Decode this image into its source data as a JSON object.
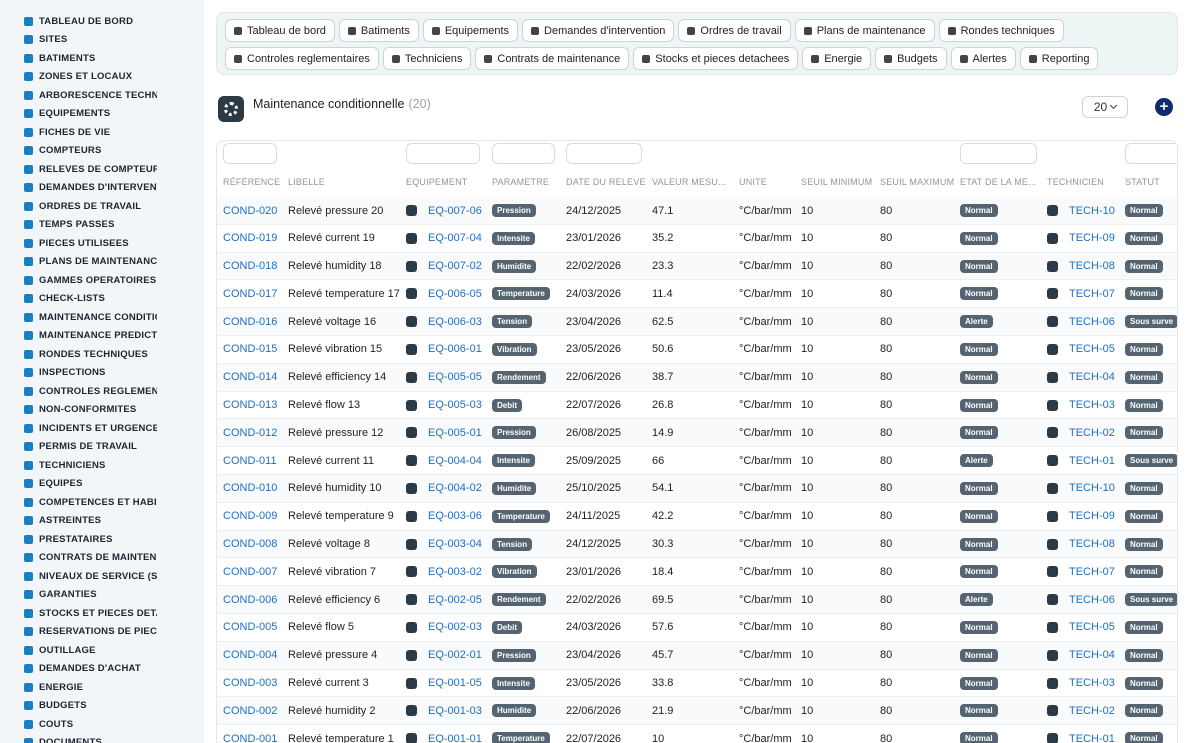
{
  "sidebar": {
    "items": [
      {
        "label": "TABLEAU DE BORD",
        "icon": "dashboard-icon"
      },
      {
        "label": "SITES",
        "icon": "location-pin-icon"
      },
      {
        "label": "BATIMENTS",
        "icon": "building-icon"
      },
      {
        "label": "ZONES ET LOCAUX",
        "icon": "grid-icon"
      },
      {
        "label": "ARBORESCENCE TECHNI",
        "icon": "hierarchy-icon"
      },
      {
        "label": "EQUIPEMENTS",
        "icon": "gears-icon"
      },
      {
        "label": "FICHES DE VIE",
        "icon": "history-icon"
      },
      {
        "label": "COMPTEURS",
        "icon": "gauge-icon"
      },
      {
        "label": "RELEVES DE COMPTEURS",
        "icon": "clipboard-icon"
      },
      {
        "label": "DEMANDES D'INTERVENT",
        "icon": "question-icon"
      },
      {
        "label": "ORDRES DE TRAVAIL",
        "icon": "clipboard-check-icon"
      },
      {
        "label": "TEMPS PASSES",
        "icon": "hourglass-icon"
      },
      {
        "label": "PIECES UTILISEES",
        "icon": "boxes-icon"
      },
      {
        "label": "PLANS DE MAINTENANCE",
        "icon": "calendar-icon"
      },
      {
        "label": "GAMMES OPERATOIRES",
        "icon": "layers-icon"
      },
      {
        "label": "CHECK-LISTS",
        "icon": "list-icon"
      },
      {
        "label": "MAINTENANCE CONDITIO",
        "icon": "thermometer-icon"
      },
      {
        "label": "MAINTENANCE PREDICTI",
        "icon": "chart-icon"
      },
      {
        "label": "RONDES TECHNIQUES",
        "icon": "route-icon"
      },
      {
        "label": "INSPECTIONS",
        "icon": "magnifier-icon"
      },
      {
        "label": "CONTROLES REGLEMENT",
        "icon": "clipboard-icon"
      },
      {
        "label": "NON-CONFORMITES",
        "icon": "alert-circle-icon"
      },
      {
        "label": "INCIDENTS ET URGENCES",
        "icon": "warning-icon"
      },
      {
        "label": "PERMIS DE TRAVAIL",
        "icon": "file-icon"
      },
      {
        "label": "TECHNICIENS",
        "icon": "helmet-icon"
      },
      {
        "label": "EQUIPES",
        "icon": "users-icon"
      },
      {
        "label": "COMPETENCES ET HABIL",
        "icon": "certificate-icon"
      },
      {
        "label": "ASTREINTES",
        "icon": "phone-icon"
      },
      {
        "label": "PRESTATAIRES",
        "icon": "handshake-icon"
      },
      {
        "label": "CONTRATS DE MAINTENA",
        "icon": "contract-icon"
      },
      {
        "label": "NIVEAUX DE SERVICE (SL",
        "icon": "stopwatch-icon"
      },
      {
        "label": "GARANTIES",
        "icon": "shield-icon"
      },
      {
        "label": "STOCKS ET PIECES DETA",
        "icon": "warehouse-icon"
      },
      {
        "label": "RESERVATIONS DE PIECE",
        "icon": "bookmark-icon"
      },
      {
        "label": "OUTILLAGE",
        "icon": "tools-icon"
      },
      {
        "label": "DEMANDES D'ACHAT",
        "icon": "cart-icon"
      },
      {
        "label": "ENERGIE",
        "icon": "bolt-icon"
      },
      {
        "label": "BUDGETS",
        "icon": "money-icon"
      },
      {
        "label": "COUTS",
        "icon": "coins-icon"
      },
      {
        "label": "DOCUMENTS",
        "icon": "folder-icon"
      }
    ]
  },
  "topnav": {
    "items": [
      {
        "label": "Tableau de bord",
        "icon": "dashboard-icon"
      },
      {
        "label": "Batiments",
        "icon": "building-icon"
      },
      {
        "label": "Equipements",
        "icon": "gears-icon"
      },
      {
        "label": "Demandes d'intervention",
        "icon": "question-icon"
      },
      {
        "label": "Ordres de travail",
        "icon": "clipboard-icon"
      },
      {
        "label": "Plans de maintenance",
        "icon": "calendar-icon"
      },
      {
        "label": "Rondes techniques",
        "icon": "route-icon"
      },
      {
        "label": "Controles reglementaires",
        "icon": "clipboard-check-icon"
      },
      {
        "label": "Techniciens",
        "icon": "helmet-icon"
      },
      {
        "label": "Contrats de maintenance",
        "icon": "contract-icon"
      },
      {
        "label": "Stocks et pieces detachees",
        "icon": "boxes-icon"
      },
      {
        "label": "Energie",
        "icon": "bolt-icon"
      },
      {
        "label": "Budgets",
        "icon": "money-icon"
      },
      {
        "label": "Alertes",
        "icon": "bell-icon"
      },
      {
        "label": "Reporting",
        "icon": "pie-chart-icon"
      }
    ]
  },
  "header": {
    "title": "Maintenance conditionnelle",
    "count": "(20)",
    "per_page": "20",
    "add_label": "+"
  },
  "table": {
    "columns": [
      "RÉFÉRENCE",
      "LIBELLE",
      "EQUIPEMENT",
      "PARAMETRE",
      "DATE DU RELEVE",
      "VALEUR MESU...",
      "UNITE",
      "SEUIL MINIMUM",
      "SEUIL MAXIMUM",
      "ETAT DE LA ME...",
      "TECHNICIEN",
      "STATUT"
    ],
    "rows": [
      {
        "ref": "COND-020",
        "libelle": "Relevé pressure 20",
        "equip": "EQ-007-06",
        "param": "Pression",
        "date": "24/12/2025",
        "valeur": "47.1",
        "unite": "°C/bar/mm",
        "min": "10",
        "max": "80",
        "etat": "Normal",
        "tech": "TECH-10",
        "statut": "Normal"
      },
      {
        "ref": "COND-019",
        "libelle": "Relevé current 19",
        "equip": "EQ-007-04",
        "param": "Intensite",
        "date": "23/01/2026",
        "valeur": "35.2",
        "unite": "°C/bar/mm",
        "min": "10",
        "max": "80",
        "etat": "Normal",
        "tech": "TECH-09",
        "statut": "Normal"
      },
      {
        "ref": "COND-018",
        "libelle": "Relevé humidity 18",
        "equip": "EQ-007-02",
        "param": "Humidite",
        "date": "22/02/2026",
        "valeur": "23.3",
        "unite": "°C/bar/mm",
        "min": "10",
        "max": "80",
        "etat": "Normal",
        "tech": "TECH-08",
        "statut": "Normal"
      },
      {
        "ref": "COND-017",
        "libelle": "Relevé temperature 17",
        "equip": "EQ-006-05",
        "param": "Temperature",
        "date": "24/03/2026",
        "valeur": "11.4",
        "unite": "°C/bar/mm",
        "min": "10",
        "max": "80",
        "etat": "Normal",
        "tech": "TECH-07",
        "statut": "Normal"
      },
      {
        "ref": "COND-016",
        "libelle": "Relevé voltage 16",
        "equip": "EQ-006-03",
        "param": "Tension",
        "date": "23/04/2026",
        "valeur": "62.5",
        "unite": "°C/bar/mm",
        "min": "10",
        "max": "80",
        "etat": "Alerte",
        "tech": "TECH-06",
        "statut": "Sous surve"
      },
      {
        "ref": "COND-015",
        "libelle": "Relevé vibration 15",
        "equip": "EQ-006-01",
        "param": "Vibration",
        "date": "23/05/2026",
        "valeur": "50.6",
        "unite": "°C/bar/mm",
        "min": "10",
        "max": "80",
        "etat": "Normal",
        "tech": "TECH-05",
        "statut": "Normal"
      },
      {
        "ref": "COND-014",
        "libelle": "Relevé efficiency 14",
        "equip": "EQ-005-05",
        "param": "Rendement",
        "date": "22/06/2026",
        "valeur": "38.7",
        "unite": "°C/bar/mm",
        "min": "10",
        "max": "80",
        "etat": "Normal",
        "tech": "TECH-04",
        "statut": "Normal"
      },
      {
        "ref": "COND-013",
        "libelle": "Relevé flow 13",
        "equip": "EQ-005-03",
        "param": "Debit",
        "date": "22/07/2026",
        "valeur": "26.8",
        "unite": "°C/bar/mm",
        "min": "10",
        "max": "80",
        "etat": "Normal",
        "tech": "TECH-03",
        "statut": "Normal"
      },
      {
        "ref": "COND-012",
        "libelle": "Relevé pressure 12",
        "equip": "EQ-005-01",
        "param": "Pression",
        "date": "26/08/2025",
        "valeur": "14.9",
        "unite": "°C/bar/mm",
        "min": "10",
        "max": "80",
        "etat": "Normal",
        "tech": "TECH-02",
        "statut": "Normal"
      },
      {
        "ref": "COND-011",
        "libelle": "Relevé current 11",
        "equip": "EQ-004-04",
        "param": "Intensite",
        "date": "25/09/2025",
        "valeur": "66",
        "unite": "°C/bar/mm",
        "min": "10",
        "max": "80",
        "etat": "Alerte",
        "tech": "TECH-01",
        "statut": "Sous surve"
      },
      {
        "ref": "COND-010",
        "libelle": "Relevé humidity 10",
        "equip": "EQ-004-02",
        "param": "Humidite",
        "date": "25/10/2025",
        "valeur": "54.1",
        "unite": "°C/bar/mm",
        "min": "10",
        "max": "80",
        "etat": "Normal",
        "tech": "TECH-10",
        "statut": "Normal"
      },
      {
        "ref": "COND-009",
        "libelle": "Relevé temperature 9",
        "equip": "EQ-003-06",
        "param": "Temperature",
        "date": "24/11/2025",
        "valeur": "42.2",
        "unite": "°C/bar/mm",
        "min": "10",
        "max": "80",
        "etat": "Normal",
        "tech": "TECH-09",
        "statut": "Normal"
      },
      {
        "ref": "COND-008",
        "libelle": "Relevé voltage 8",
        "equip": "EQ-003-04",
        "param": "Tension",
        "date": "24/12/2025",
        "valeur": "30.3",
        "unite": "°C/bar/mm",
        "min": "10",
        "max": "80",
        "etat": "Normal",
        "tech": "TECH-08",
        "statut": "Normal"
      },
      {
        "ref": "COND-007",
        "libelle": "Relevé vibration 7",
        "equip": "EQ-003-02",
        "param": "Vibration",
        "date": "23/01/2026",
        "valeur": "18.4",
        "unite": "°C/bar/mm",
        "min": "10",
        "max": "80",
        "etat": "Normal",
        "tech": "TECH-07",
        "statut": "Normal"
      },
      {
        "ref": "COND-006",
        "libelle": "Relevé efficiency 6",
        "equip": "EQ-002-05",
        "param": "Rendement",
        "date": "22/02/2026",
        "valeur": "69.5",
        "unite": "°C/bar/mm",
        "min": "10",
        "max": "80",
        "etat": "Alerte",
        "tech": "TECH-06",
        "statut": "Sous surve"
      },
      {
        "ref": "COND-005",
        "libelle": "Relevé flow 5",
        "equip": "EQ-002-03",
        "param": "Debit",
        "date": "24/03/2026",
        "valeur": "57.6",
        "unite": "°C/bar/mm",
        "min": "10",
        "max": "80",
        "etat": "Normal",
        "tech": "TECH-05",
        "statut": "Normal"
      },
      {
        "ref": "COND-004",
        "libelle": "Relevé pressure 4",
        "equip": "EQ-002-01",
        "param": "Pression",
        "date": "23/04/2026",
        "valeur": "45.7",
        "unite": "°C/bar/mm",
        "min": "10",
        "max": "80",
        "etat": "Normal",
        "tech": "TECH-04",
        "statut": "Normal"
      },
      {
        "ref": "COND-003",
        "libelle": "Relevé current 3",
        "equip": "EQ-001-05",
        "param": "Intensite",
        "date": "23/05/2026",
        "valeur": "33.8",
        "unite": "°C/bar/mm",
        "min": "10",
        "max": "80",
        "etat": "Normal",
        "tech": "TECH-03",
        "statut": "Normal"
      },
      {
        "ref": "COND-002",
        "libelle": "Relevé humidity 2",
        "equip": "EQ-001-03",
        "param": "Humidite",
        "date": "22/06/2026",
        "valeur": "21.9",
        "unite": "°C/bar/mm",
        "min": "10",
        "max": "80",
        "etat": "Normal",
        "tech": "TECH-02",
        "statut": "Normal"
      },
      {
        "ref": "COND-001",
        "libelle": "Relevé temperature 1",
        "equip": "EQ-001-01",
        "param": "Temperature",
        "date": "22/07/2026",
        "valeur": "10",
        "unite": "°C/bar/mm",
        "min": "10",
        "max": "80",
        "etat": "Normal",
        "tech": "TECH-01",
        "statut": "Normal"
      }
    ]
  },
  "colors": {
    "accent": "#1d6fc2",
    "sidebar_bg": "#f3f6f9",
    "nav_bg": "#eef5f5",
    "badge": "#556470",
    "add_button": "#102a6b"
  }
}
